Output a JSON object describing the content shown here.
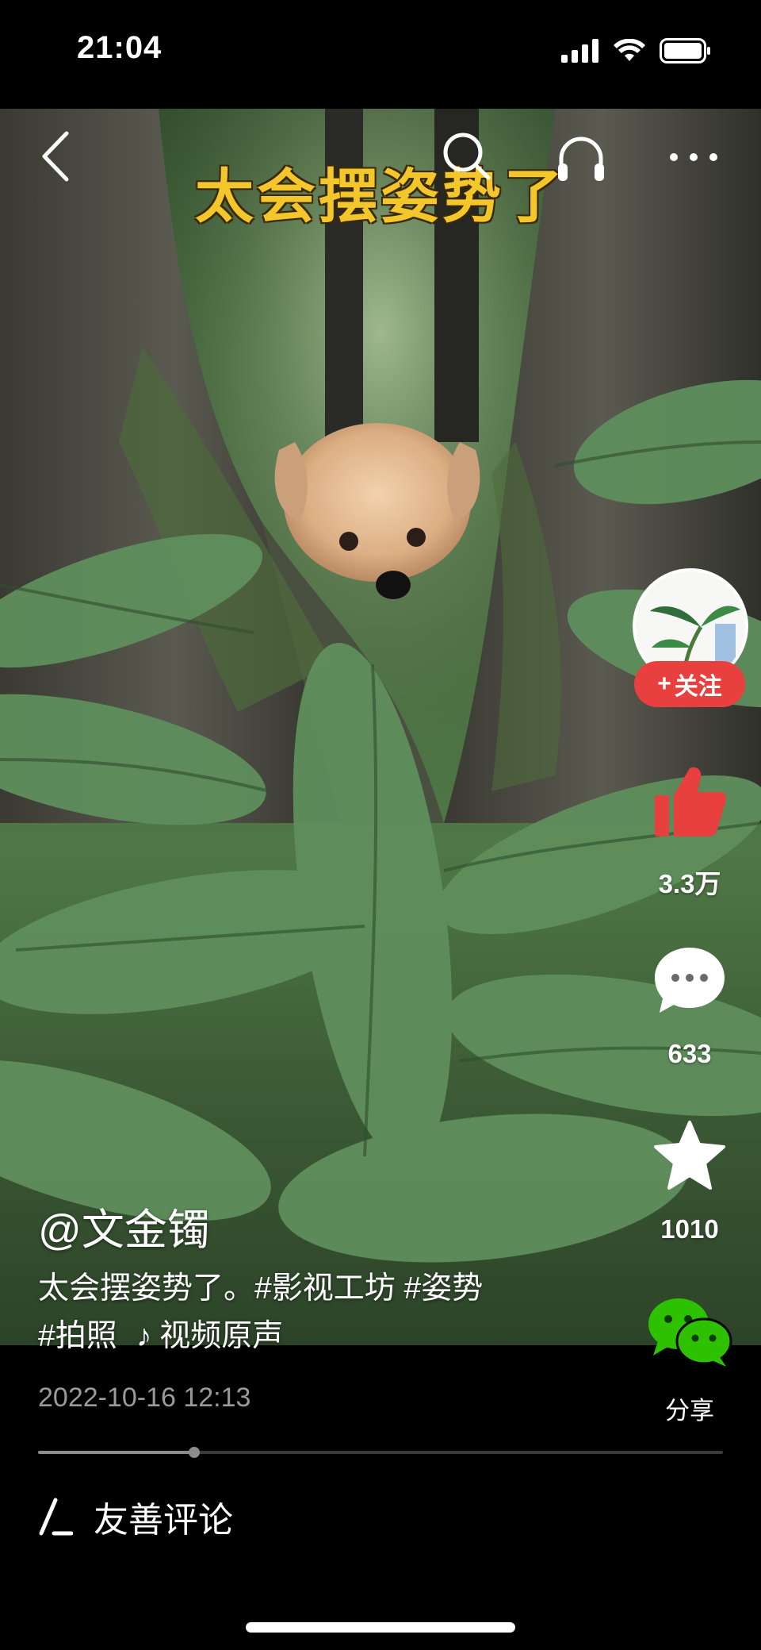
{
  "status_bar": {
    "time": "21:04"
  },
  "video": {
    "caption_overlay": "太会摆姿势了"
  },
  "top_bar": {
    "icons": [
      "back-icon",
      "search-icon",
      "headphones-icon",
      "more-icon"
    ]
  },
  "author": {
    "handle": "@文金镯",
    "follow_label": "关注"
  },
  "description": {
    "text": "太会摆姿势了。#影视工坊 #姿势",
    "tags_line": "#拍照",
    "music": "视频原声"
  },
  "actions": {
    "likes": "3.3万",
    "comments": "633",
    "favorites": "1010",
    "share_label": "分享"
  },
  "post": {
    "date": "2022-10-16 12:13"
  },
  "playback": {
    "progress": 0.228
  },
  "comment_input": {
    "label": "友善评论"
  },
  "colors": {
    "accent_red": "#e8403f",
    "caption_yellow": "#f3c62c",
    "wechat_green": "#2dc100"
  }
}
